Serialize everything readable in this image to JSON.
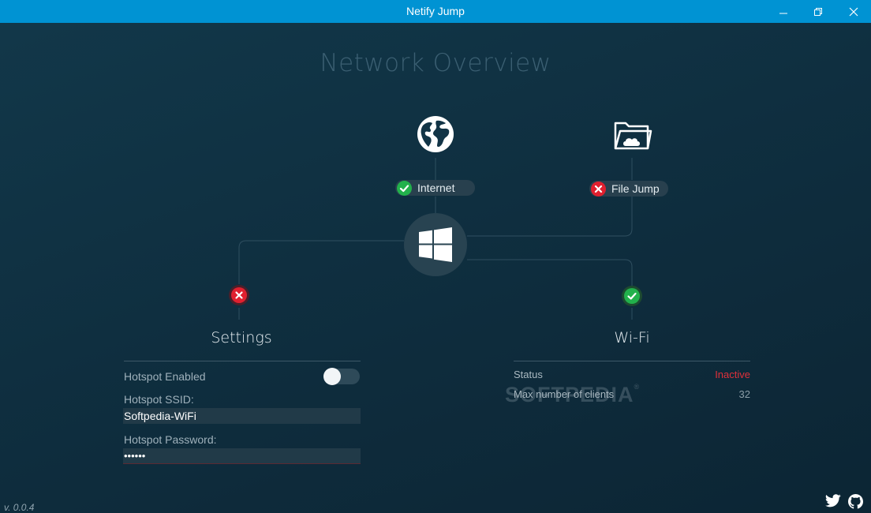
{
  "window": {
    "title": "Netify Jump",
    "controls": [
      "minimize-icon",
      "restore-icon",
      "close-icon"
    ]
  },
  "overview": {
    "title": "Network Overview"
  },
  "nodes": {
    "internet": {
      "label": "Internet",
      "status": "ok",
      "icon": "globe-icon"
    },
    "file_jump": {
      "label": "File Jump",
      "status": "error",
      "icon": "cloud-folder-icon"
    },
    "hub": {
      "icon": "windows-logo-icon"
    },
    "settings": {
      "status": "error"
    },
    "wifi": {
      "status": "ok"
    }
  },
  "settings": {
    "title": "Settings",
    "hotspot_enabled_label": "Hotspot Enabled",
    "hotspot_enabled": false,
    "ssid_label": "Hotspot SSID:",
    "ssid_value": "Softpedia-WiFi",
    "password_label": "Hotspot Password:",
    "password_value": "••••••"
  },
  "wifi": {
    "title": "Wi-Fi",
    "status_label": "Status",
    "status_value": "Inactive",
    "max_clients_label": "Max number of clients",
    "max_clients_value": "32"
  },
  "footer": {
    "version": "v. 0.0.4",
    "links": [
      "twitter-icon",
      "github-icon"
    ]
  },
  "watermark": {
    "text": "SOFTPEDIA",
    "mark": "®"
  },
  "colors": {
    "titlebar": "#0093d3",
    "ok": "#22b14c",
    "error": "#e0202f",
    "inactive": "#e0303a"
  }
}
